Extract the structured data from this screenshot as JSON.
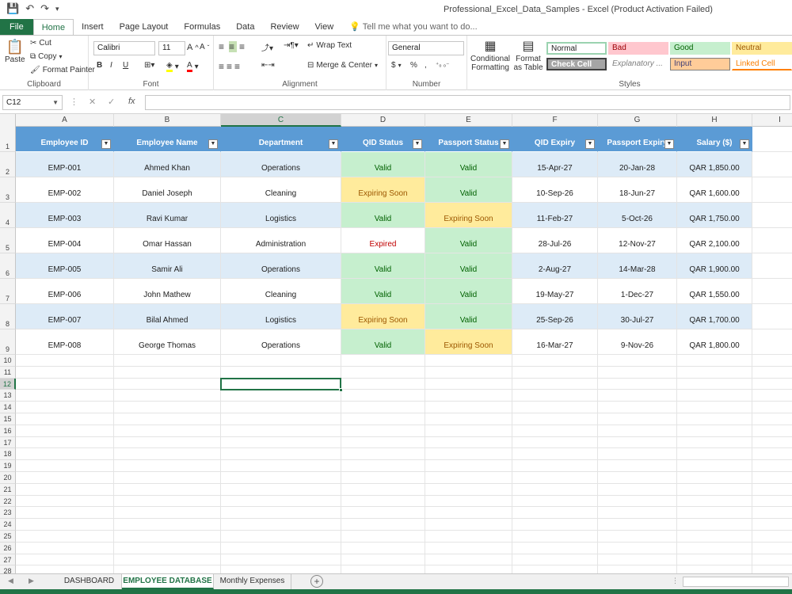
{
  "window": {
    "title": "Professional_Excel_Data_Samples - Excel (Product Activation Failed)"
  },
  "ribbon_tabs": [
    {
      "label": "File"
    },
    {
      "label": "Home"
    },
    {
      "label": "Insert"
    },
    {
      "label": "Page Layout"
    },
    {
      "label": "Formulas"
    },
    {
      "label": "Data"
    },
    {
      "label": "Review"
    },
    {
      "label": "View"
    }
  ],
  "tell_me": "Tell me what you want to do...",
  "clipboard": {
    "paste": "Paste",
    "cut": "Cut",
    "copy": "Copy",
    "format_painter": "Format Painter",
    "label": "Clipboard"
  },
  "font": {
    "name": "Calibri",
    "size": "11",
    "label": "Font",
    "bold": "B",
    "italic": "I",
    "underline": "U"
  },
  "alignment": {
    "wrap": "Wrap Text",
    "merge": "Merge & Center",
    "label": "Alignment"
  },
  "number": {
    "format": "General",
    "currency": "$",
    "percent": "%",
    "comma": ",",
    "label": "Number"
  },
  "styles": {
    "conditional": "Conditional Formatting",
    "format_table": "Format as Table",
    "label": "Styles",
    "cells": [
      {
        "label": "Normal",
        "bg": "#ffffff",
        "fg": "#000000",
        "italic": false
      },
      {
        "label": "Bad",
        "bg": "#ffc7ce",
        "fg": "#9c0006",
        "italic": false
      },
      {
        "label": "Good",
        "bg": "#c6efce",
        "fg": "#006100",
        "italic": false
      },
      {
        "label": "Neutral",
        "bg": "#ffeb9c",
        "fg": "#9c5700",
        "italic": false
      },
      {
        "label": "Check Cell",
        "bg": "#a5a5a5",
        "fg": "#ffffff",
        "italic": false
      },
      {
        "label": "Explanatory ...",
        "bg": "#ffffff",
        "fg": "#7f7f7f",
        "italic": true
      },
      {
        "label": "Input",
        "bg": "#ffcc99",
        "fg": "#3f3f76",
        "italic": false
      },
      {
        "label": "Linked Cell",
        "bg": "#ffffff",
        "fg": "#fa7d00",
        "italic": false
      }
    ]
  },
  "formula_bar": {
    "name_box": "C12",
    "fx": "fx",
    "value": ""
  },
  "columns": [
    "A",
    "B",
    "C",
    "D",
    "E",
    "F",
    "G",
    "H",
    "I"
  ],
  "table": {
    "headers": [
      "Employee ID",
      "Employee Name",
      "Department",
      "QID Status",
      "Passport Status",
      "QID Expiry",
      "Passport Expiry",
      "Salary ($)"
    ],
    "rows": [
      [
        "EMP-001",
        "Ahmed Khan",
        "Operations",
        "Valid",
        "Valid",
        "15-Apr-27",
        "20-Jan-28",
        "QAR 1,850.00"
      ],
      [
        "EMP-002",
        "Daniel Joseph",
        "Cleaning",
        "Expiring Soon",
        "Valid",
        "10-Sep-26",
        "18-Jun-27",
        "QAR 1,600.00"
      ],
      [
        "EMP-003",
        "Ravi Kumar",
        "Logistics",
        "Valid",
        "Expiring Soon",
        "11-Feb-27",
        "5-Oct-26",
        "QAR 1,750.00"
      ],
      [
        "EMP-004",
        "Omar Hassan",
        "Administration",
        "Expired",
        "Valid",
        "28-Jul-26",
        "12-Nov-27",
        "QAR 2,100.00"
      ],
      [
        "EMP-005",
        "Samir Ali",
        "Operations",
        "Valid",
        "Valid",
        "2-Aug-27",
        "14-Mar-28",
        "QAR 1,900.00"
      ],
      [
        "EMP-006",
        "John Mathew",
        "Cleaning",
        "Valid",
        "Valid",
        "19-May-27",
        "1-Dec-27",
        "QAR 1,550.00"
      ],
      [
        "EMP-007",
        "Bilal Ahmed",
        "Logistics",
        "Expiring Soon",
        "Valid",
        "25-Sep-26",
        "30-Jul-27",
        "QAR 1,700.00"
      ],
      [
        "EMP-008",
        "George Thomas",
        "Operations",
        "Valid",
        "Expiring Soon",
        "16-Mar-27",
        "9-Nov-26",
        "QAR 1,800.00"
      ]
    ]
  },
  "row_numbers": [
    "1",
    "2",
    "3",
    "4",
    "5",
    "6",
    "7",
    "8",
    "9",
    "10",
    "11",
    "12",
    "13",
    "14",
    "15",
    "16",
    "17",
    "18",
    "19",
    "20",
    "21",
    "22",
    "23",
    "24",
    "25",
    "26",
    "27",
    "28"
  ],
  "active_cell": "C12",
  "sheets": [
    {
      "label": "DASHBOARD",
      "active": false
    },
    {
      "label": "EMPLOYEE DATABASE",
      "active": true
    },
    {
      "label": "Monthly Expenses",
      "active": false
    }
  ],
  "colors": {
    "excel_green": "#217346",
    "header_blue": "#5b9bd5",
    "band_blue": "#ddebf7"
  }
}
